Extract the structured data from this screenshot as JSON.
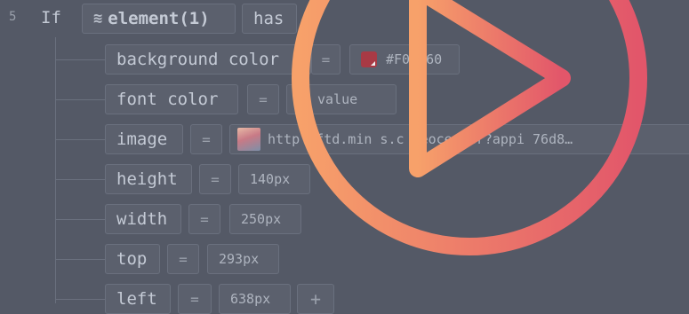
{
  "line": {
    "number": "5",
    "if_label": "If",
    "element_label": "element(1)",
    "has_label": "has"
  },
  "properties": [
    {
      "name": "background color",
      "op": "=",
      "value": "#F0 060",
      "kind": "color",
      "color": "#a83a45"
    },
    {
      "name": "font color",
      "op": "=",
      "value": "value",
      "kind": "placeholder"
    },
    {
      "name": "image",
      "op": "=",
      "value": "http /ftd.min s.c deocenter?appi 76d8…",
      "kind": "image"
    },
    {
      "name": "height",
      "op": "=",
      "value": "140px",
      "kind": "text"
    },
    {
      "name": "width",
      "op": "=",
      "value": "250px",
      "kind": "text"
    },
    {
      "name": "top",
      "op": "=",
      "value": "293px",
      "kind": "text"
    },
    {
      "name": "left",
      "op": "=",
      "value": "638px",
      "kind": "text"
    }
  ],
  "add_button": "+",
  "icons": {
    "element": "stack-icon",
    "play": "play-icon",
    "add": "plus-icon"
  },
  "colors": {
    "background": "#545966",
    "play_gradient_start": "#f7a16a",
    "play_gradient_end": "#e2566a"
  }
}
